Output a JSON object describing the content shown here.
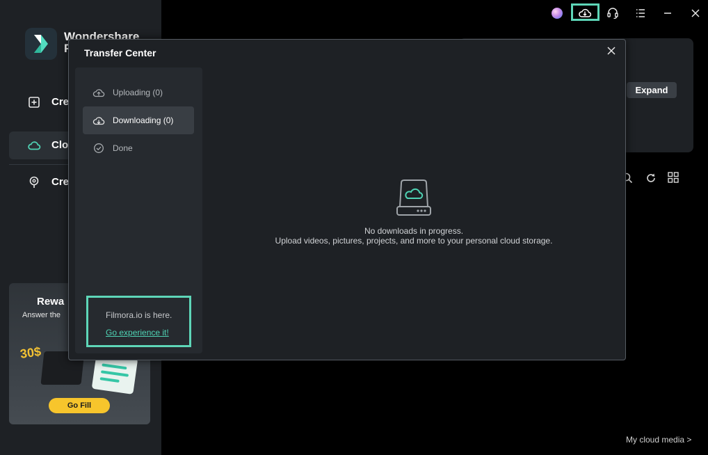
{
  "app": {
    "brand_line1": "Wondershare",
    "brand_line2": "F"
  },
  "titlebar": {
    "icons": [
      "avatar",
      "cloud-transfer-icon",
      "headset-icon",
      "menu-icon",
      "minimize-icon",
      "close-icon"
    ]
  },
  "sidebar": {
    "items": [
      {
        "label": "Cre",
        "icon": "add-square-icon",
        "active": false
      },
      {
        "label": "Clo",
        "icon": "cloud-icon",
        "active": true
      },
      {
        "label": "Cre",
        "icon": "lightbulb-icon",
        "active": false
      }
    ],
    "promo": {
      "title": "Rewa",
      "subtitle": "Answer the",
      "amount": "30$",
      "button": "Go Fill"
    }
  },
  "main": {
    "expand_label": "Expand",
    "toolbar_icons": [
      "search-icon",
      "refresh-icon",
      "grid-view-icon"
    ],
    "cloud_link": "My cloud media >"
  },
  "transfer_center": {
    "title": "Transfer Center",
    "tabs": [
      {
        "label": "Uploading (0)",
        "icon": "upload-cloud-icon",
        "active": false
      },
      {
        "label": "Downloading (0)",
        "icon": "download-cloud-icon",
        "active": true
      },
      {
        "label": "Done",
        "icon": "check-circle-icon",
        "active": false
      }
    ],
    "promo_text": "Filmora.io is here.",
    "promo_link": "Go experience it!",
    "empty_title": "No downloads in progress.",
    "empty_desc": "Upload videos, pictures, projects, and more to your personal cloud storage."
  },
  "colors": {
    "accent": "#5ed6b8",
    "modal_bg": "#1e2125",
    "panel_bg": "#262a2f"
  }
}
